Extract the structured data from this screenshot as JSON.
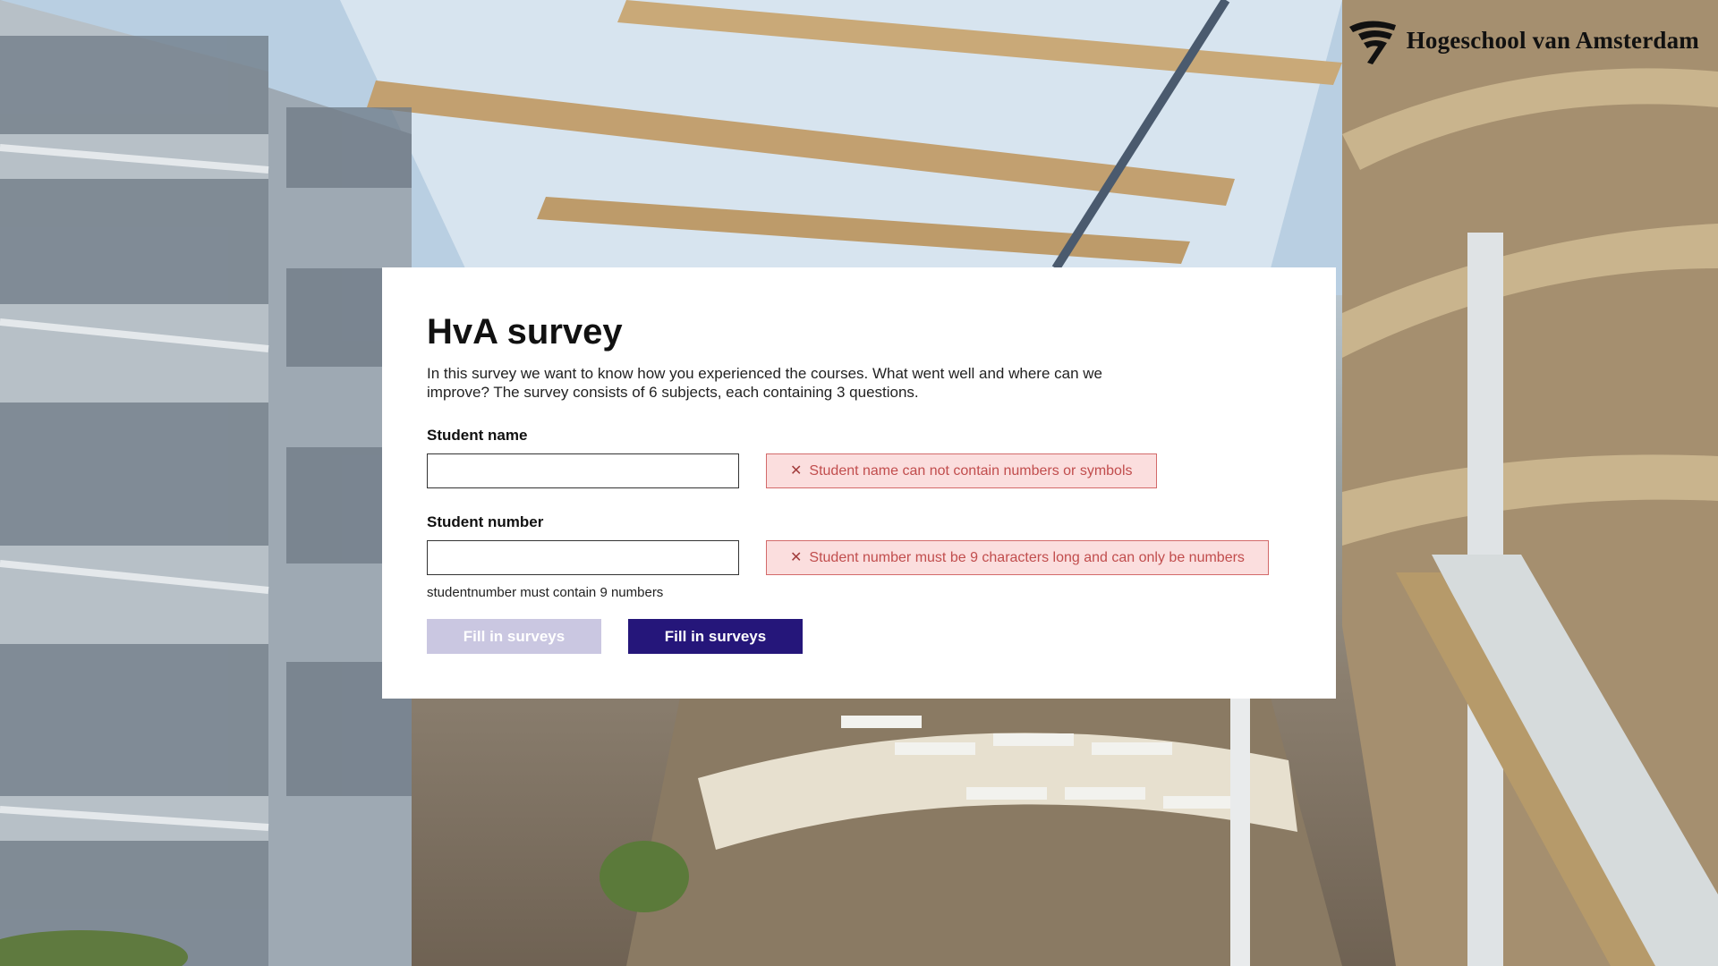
{
  "brand": {
    "name": "Hogeschool van Amsterdam",
    "logo_icon": "hva-swirl-logo-icon"
  },
  "survey": {
    "title": "HvA survey",
    "intro": "In this survey we want to know how you experienced the courses. What went well and where can we improve? The survey consists of 6 subjects, each containing 3 questions."
  },
  "fields": {
    "student_name": {
      "label": "Student name",
      "value": "",
      "error": "Student name can not contain numbers or symbols",
      "error_icon": "close-x-icon"
    },
    "student_number": {
      "label": "Student number",
      "value": "",
      "error": "Student number must be 9 characters long and can only be numbers",
      "error_icon": "close-x-icon",
      "hint": "studentnumber must contain 9 numbers"
    }
  },
  "buttons": {
    "disabled_label": "Fill in surveys",
    "primary_label": "Fill in surveys"
  },
  "colors": {
    "primary": "#25167a",
    "primary_disabled": "#cac7e1",
    "error_bg": "#fbdede",
    "error_border": "#d36a6a",
    "error_text": "#c14d4d"
  }
}
